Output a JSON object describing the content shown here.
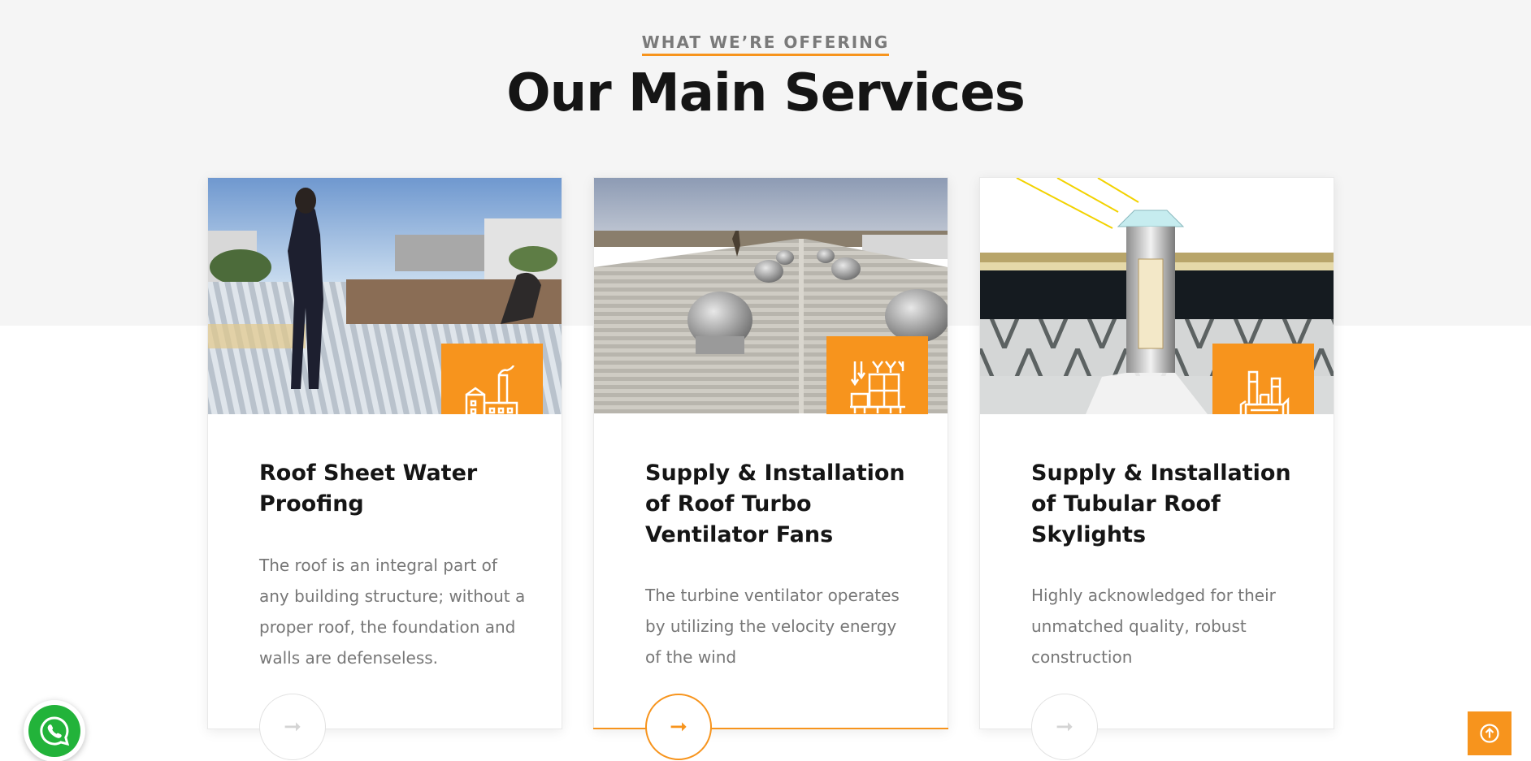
{
  "section": {
    "eyebrow": "WHAT WE’RE OFFERING",
    "title": "Our Main Services"
  },
  "services": [
    {
      "title": "Roof Sheet Water Proofing",
      "description": "The roof is an integral part of any building structure; without a proper roof, the foundation and walls are defenseless.",
      "icon": "factory-icon",
      "arrow": "➞"
    },
    {
      "title": "Supply & Installation of Roof Turbo Ventilator Fans",
      "description": "The turbine ventilator operates by utilizing the velocity energy of the wind",
      "icon": "warehouse-ventilation-icon",
      "arrow": "➞"
    },
    {
      "title": "Supply & Installation of Tubular Roof Skylights",
      "description": "Highly acknowledged for their unmatched quality, robust construction",
      "icon": "industrial-plant-icon",
      "arrow": "➞"
    }
  ],
  "floating": {
    "whatsapp_icon": "whatsapp-icon",
    "back_to_top_icon": "arrow-up-circle-icon"
  },
  "colors": {
    "accent": "#f7941d",
    "title": "#151515",
    "body_text": "#777777",
    "band": "#f5f5f5",
    "whatsapp": "#22b33a"
  }
}
